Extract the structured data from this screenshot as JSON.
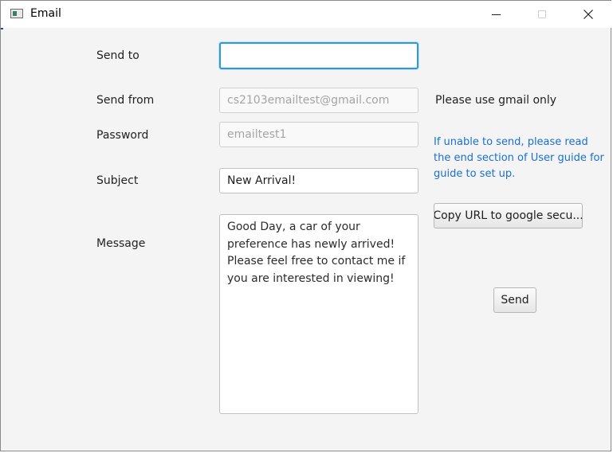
{
  "window": {
    "title": "Email",
    "minimize_icon": "minimize-icon",
    "maximize_icon": "maximize-icon",
    "close_icon": "close-icon"
  },
  "form": {
    "send_to": {
      "label": "Send to",
      "value": ""
    },
    "send_from": {
      "label": "Send from",
      "value": "cs2103emailtest@gmail.com"
    },
    "password": {
      "label": "Password",
      "value": "emailtest1"
    },
    "subject": {
      "label": "Subject",
      "value": "New Arrival!"
    },
    "message": {
      "label": "Message",
      "value": "Good Day, a car of your\npreference has newly arrived!\nPlease feel free to contact me if\nyou are interested in viewing!"
    }
  },
  "side": {
    "gmail_hint": "Please use gmail only",
    "info_note": "If unable to send, please read the end section of User guide for guide to set up.",
    "copy_url_button": "Copy URL to google secu...",
    "send_button": "Send"
  },
  "colors": {
    "note_blue": "#1a6fd1",
    "focus_blue": "#2d9ad9"
  }
}
